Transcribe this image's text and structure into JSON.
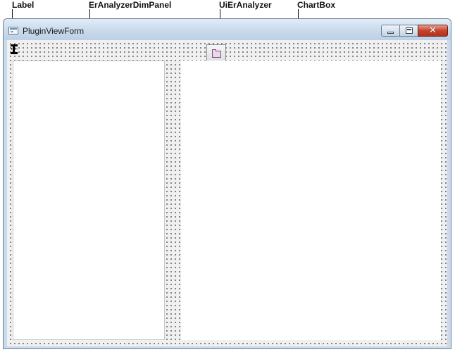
{
  "callouts": {
    "label": "Label",
    "dim_panel": "ErAnalyzerDimPanel",
    "analyzer": "UiErAnalyzer",
    "chart_box": "ChartBox"
  },
  "window": {
    "title": "PluginViewForm",
    "buttons": {
      "minimize_icon": "minimize-icon",
      "maximize_icon": "maximize-icon",
      "close_glyph": "✕"
    }
  },
  "controls": {
    "label_control_icon": "label-control-icon",
    "analyzer_button_icon": "folder-icon",
    "dim_panel_content": "",
    "chart_box_content": ""
  },
  "colors": {
    "close_button": "#c5432b",
    "titlebar": "#c9daeb",
    "form_background": "#f0f0f0"
  }
}
